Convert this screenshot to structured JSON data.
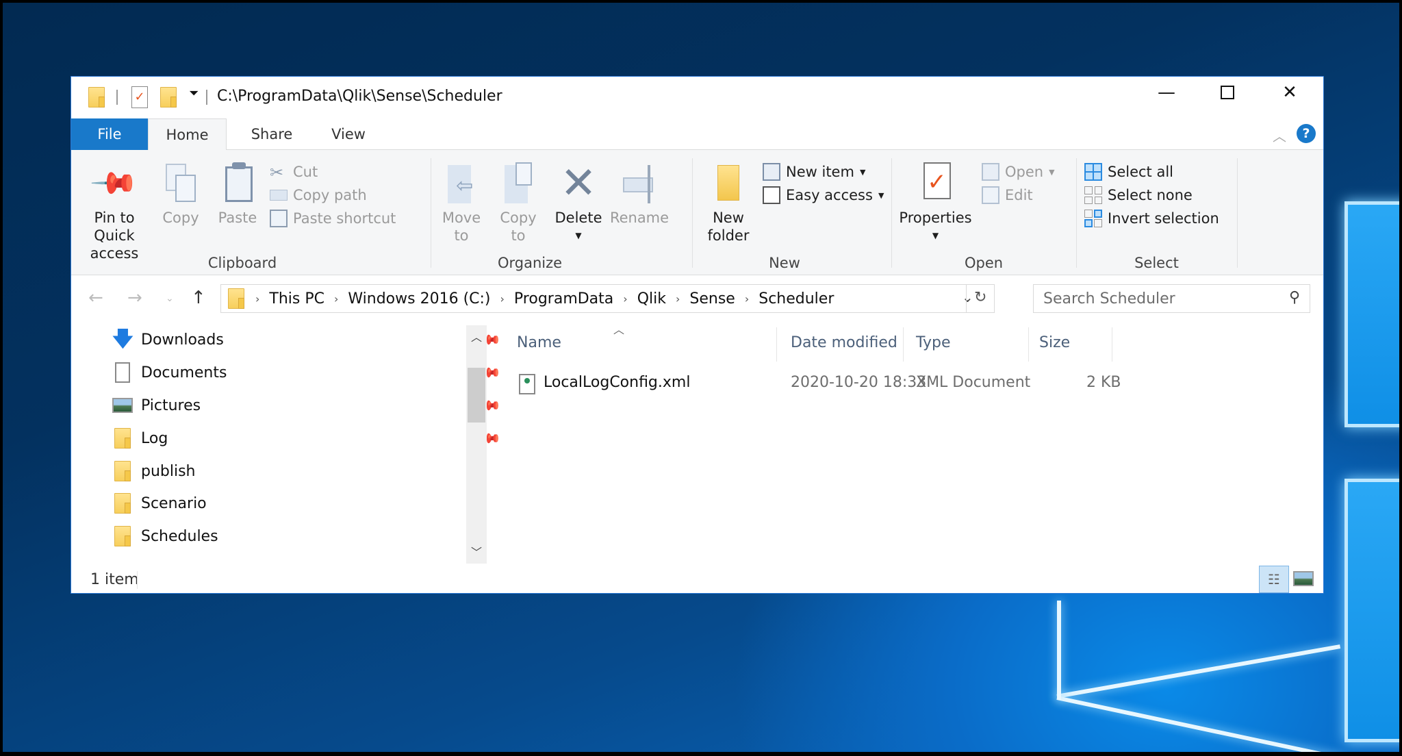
{
  "window": {
    "title": "C:\\ProgramData\\Qlik\\Sense\\Scheduler",
    "controls": {
      "minimize": "—",
      "maximize": "☐",
      "close": "✕"
    }
  },
  "tabs": [
    {
      "label": "File",
      "active": false
    },
    {
      "label": "Home",
      "active": true
    },
    {
      "label": "Share",
      "active": false
    },
    {
      "label": "View",
      "active": false
    }
  ],
  "ribbon": {
    "groups": {
      "clipboard": {
        "label": "Clipboard",
        "pin": "Pin to Quick access",
        "pin_l1": "Pin to Quick",
        "pin_l2": "access",
        "copy": "Copy",
        "paste": "Paste",
        "cut": "Cut",
        "copy_path": "Copy path",
        "paste_shortcut": "Paste shortcut"
      },
      "organize": {
        "label": "Organize",
        "move_l1": "Move",
        "move_l2": "to",
        "copy_l1": "Copy",
        "copy_l2": "to",
        "delete": "Delete",
        "rename": "Rename"
      },
      "new": {
        "label": "New",
        "new_folder_l1": "New",
        "new_folder_l2": "folder",
        "new_item": "New item",
        "easy_access": "Easy access"
      },
      "open": {
        "label": "Open",
        "properties": "Properties",
        "open": "Open",
        "edit": "Edit"
      },
      "select": {
        "label": "Select",
        "select_all": "Select all",
        "select_none": "Select none",
        "invert": "Invert selection"
      }
    }
  },
  "address": {
    "crumbs": [
      "This PC",
      "Windows 2016 (C:)",
      "ProgramData",
      "Qlik",
      "Sense",
      "Scheduler"
    ],
    "search_placeholder": "Search Scheduler"
  },
  "nav": {
    "items": [
      {
        "label": "Downloads",
        "icon": "download-icon",
        "pinned": true
      },
      {
        "label": "Documents",
        "icon": "documents-icon",
        "pinned": true
      },
      {
        "label": "Pictures",
        "icon": "pictures-icon",
        "pinned": true
      },
      {
        "label": "Log",
        "icon": "folder-icon",
        "pinned": true
      },
      {
        "label": "publish",
        "icon": "folder-icon",
        "pinned": false
      },
      {
        "label": "Scenario",
        "icon": "folder-icon",
        "pinned": false
      },
      {
        "label": "Schedules",
        "icon": "folder-icon",
        "pinned": false
      }
    ]
  },
  "files": {
    "columns": [
      "Name",
      "Date modified",
      "Type",
      "Size"
    ],
    "sort_column": "Name",
    "rows": [
      {
        "name": "LocalLogConfig.xml",
        "modified": "2020-10-20 18:33",
        "type": "XML Document",
        "size": "2 KB"
      }
    ]
  },
  "status": {
    "count": "1 item"
  },
  "colors": {
    "accent": "#1979ca",
    "header_text": "#4c607a",
    "folder": "#f7cf5c"
  }
}
